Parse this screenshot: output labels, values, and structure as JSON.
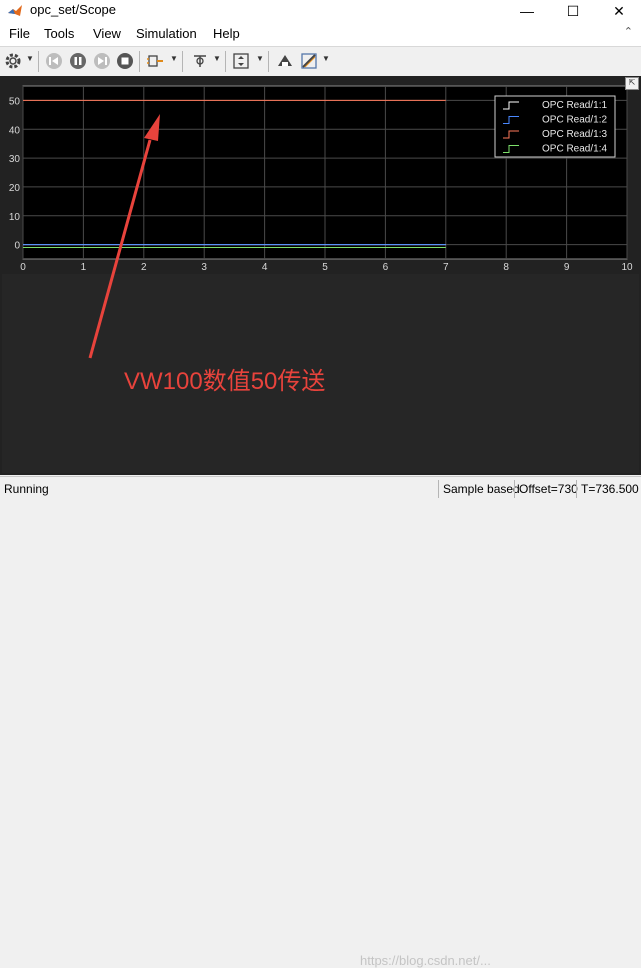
{
  "window": {
    "title": "opc_set/Scope",
    "controls": [
      "—",
      "☐",
      "✕"
    ]
  },
  "menu": [
    "File",
    "Tools",
    "View",
    "Simulation",
    "Help"
  ],
  "toolbar_icons": [
    "gear-icon",
    "step-back-icon",
    "pause-icon",
    "step-forward-icon",
    "stop-icon",
    "signal-select-icon",
    "trigger-icon",
    "scale-axes-icon",
    "style-icon",
    "measure-icon"
  ],
  "chart_data": {
    "type": "line",
    "xlim": [
      0,
      10
    ],
    "ylim": [
      -5,
      55
    ],
    "xticks": [
      "0",
      "1",
      "2",
      "3",
      "4",
      "5",
      "6",
      "7",
      "8",
      "9",
      "10"
    ],
    "yticks": [
      "50",
      "40",
      "30",
      "20",
      "10",
      "0"
    ],
    "grid": true,
    "legend_placement": "top-right",
    "series": [
      {
        "name": "OPC Read/1:1",
        "color": "#ffffff",
        "x": [
          0,
          7
        ],
        "y": [
          0,
          0
        ]
      },
      {
        "name": "OPC Read/1:2",
        "color": "#4a88ff",
        "x": [
          0,
          7
        ],
        "y": [
          0,
          0
        ]
      },
      {
        "name": "OPC Read/1:3",
        "color": "#ff7a5c",
        "x": [
          0,
          7
        ],
        "y": [
          50,
          50
        ]
      },
      {
        "name": "OPC Read/1:4",
        "color": "#7de06a",
        "x": [
          0,
          7
        ],
        "y": [
          -1,
          -1
        ]
      }
    ]
  },
  "annotation": {
    "text": "VW100数值50传送",
    "color": "#e8433c"
  },
  "status": {
    "state": "Running",
    "mode": "Sample based",
    "offset": "Offset=730",
    "time": "T=736.500"
  },
  "watermark": "https://blog.csdn.net/..."
}
